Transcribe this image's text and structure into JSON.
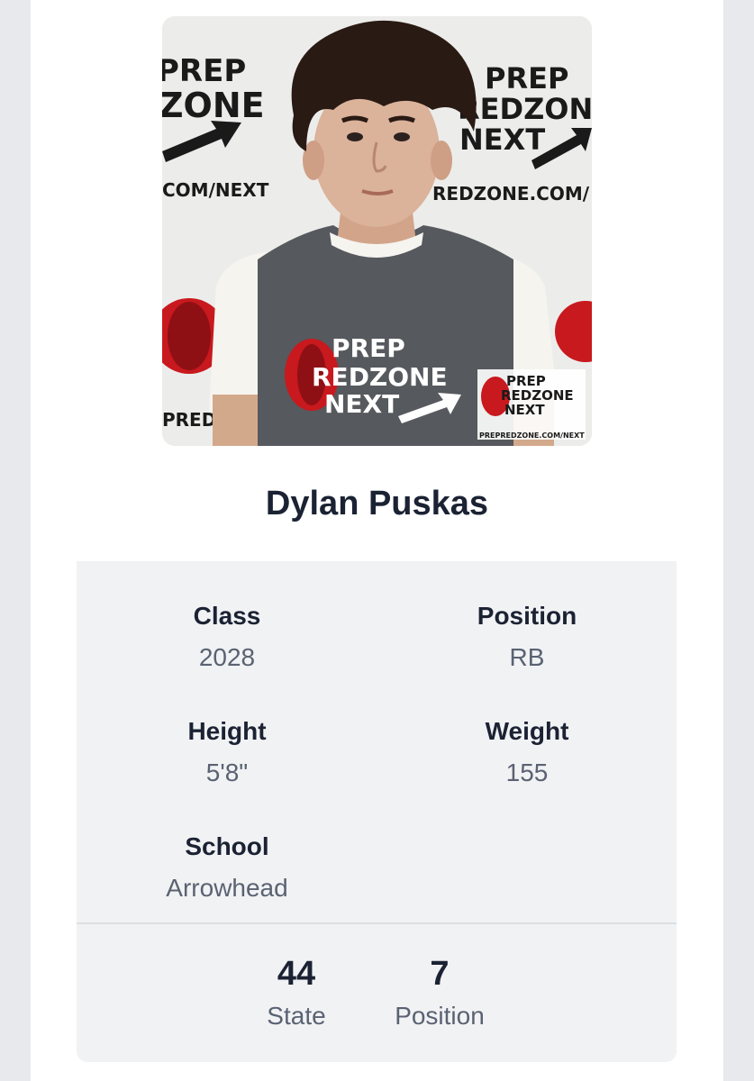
{
  "player": {
    "name": "Dylan Puskas",
    "photo_alt": "Player headshot"
  },
  "photo_branding": {
    "backdrop_left_line1": "PREP",
    "backdrop_left_line2": "ZONE",
    "backdrop_left_url": "COM/NEXT",
    "backdrop_right_line1": "PREP",
    "backdrop_right_line2": "REDZONE",
    "backdrop_right_line3": "NEXT",
    "backdrop_right_url": "REDZONE.COM/",
    "backdrop_bottom_left": "PRED",
    "shirt_line1": "PREP",
    "shirt_line2": "REDZONE",
    "shirt_line3": "NEXT",
    "watermark_line1": "PREP",
    "watermark_line2": "REDZONE",
    "watermark_line3": "NEXT",
    "watermark_url": "PREPREDZONE.COM/NEXT"
  },
  "attributes": {
    "class_label": "Class",
    "class_value": "2028",
    "position_label": "Position",
    "position_value": "RB",
    "height_label": "Height",
    "height_value": "5'8\"",
    "weight_label": "Weight",
    "weight_value": "155",
    "school_label": "School",
    "school_value": "Arrowhead"
  },
  "rankings": {
    "state_value": "44",
    "state_label": "State",
    "position_value": "7",
    "position_label": "Position"
  },
  "colors": {
    "brand_red": "#c8191e",
    "shirt_gray": "#56595d",
    "text_dark": "#1b2233",
    "text_muted": "#5a6272",
    "panel_bg": "#f1f2f4"
  }
}
